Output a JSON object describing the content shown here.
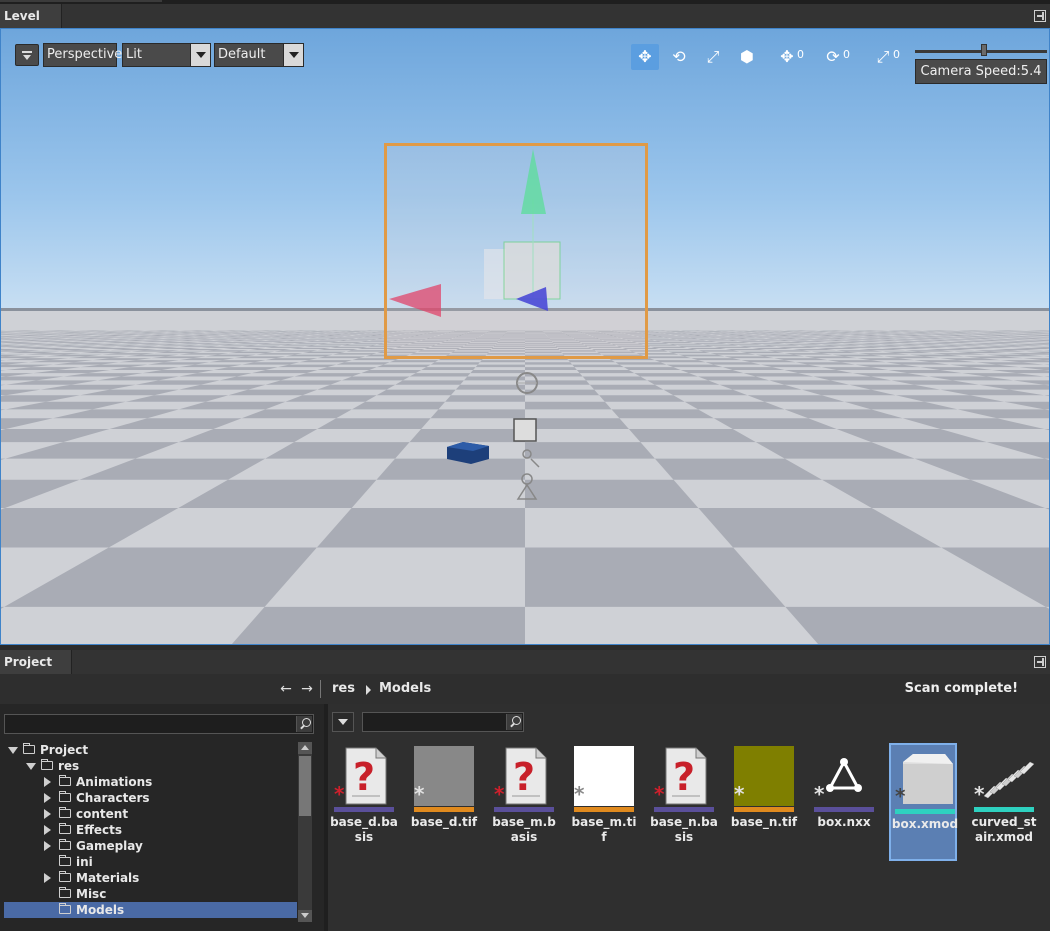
{
  "level_panel": {
    "title": "Level"
  },
  "viewport": {
    "projection": "Perspective",
    "shading": "Lit",
    "preset": "Default",
    "snap_counts": {
      "translate": "0",
      "rotate": "0",
      "scale": "0"
    },
    "camera_speed": "Camera Speed:5.4",
    "camera_speed_level": 0.52
  },
  "project_panel": {
    "title": "Project",
    "breadcrumb": [
      "res",
      "Models"
    ],
    "status": "Scan complete!",
    "tree": [
      {
        "label": "Project",
        "depth": 0,
        "state": "open"
      },
      {
        "label": "res",
        "depth": 1,
        "state": "open"
      },
      {
        "label": "Animations",
        "depth": 2,
        "state": "closed"
      },
      {
        "label": "Characters",
        "depth": 2,
        "state": "closed"
      },
      {
        "label": "content",
        "depth": 2,
        "state": "closed"
      },
      {
        "label": "Effects",
        "depth": 2,
        "state": "closed"
      },
      {
        "label": "Gameplay",
        "depth": 2,
        "state": "closed"
      },
      {
        "label": "ini",
        "depth": 2,
        "state": "none"
      },
      {
        "label": "Materials",
        "depth": 2,
        "state": "closed"
      },
      {
        "label": "Misc",
        "depth": 2,
        "state": "none"
      },
      {
        "label": "Models",
        "depth": 2,
        "state": "none",
        "selected": true
      }
    ],
    "assets": [
      {
        "name": "base_d.basis",
        "kind": "unknown",
        "bar": "#5a4f9a"
      },
      {
        "name": "base_d.tif",
        "kind": "gray",
        "bar": "#e08a1e"
      },
      {
        "name": "base_m.basis",
        "kind": "unknown",
        "bar": "#5a4f9a"
      },
      {
        "name": "base_m.tif",
        "kind": "white",
        "bar": "#e08a1e"
      },
      {
        "name": "base_n.basis",
        "kind": "unknown",
        "bar": "#5a4f9a"
      },
      {
        "name": "base_n.tif",
        "kind": "olive",
        "bar": "#e08a1e"
      },
      {
        "name": "box.nxx",
        "kind": "mesh",
        "bar": "#5a4f9a"
      },
      {
        "name": "box.xmod",
        "kind": "box",
        "bar": "#2ed1c0",
        "selected": true
      },
      {
        "name": "curved_stair.xmod",
        "kind": "stair",
        "bar": "#2ed1c0"
      }
    ]
  }
}
